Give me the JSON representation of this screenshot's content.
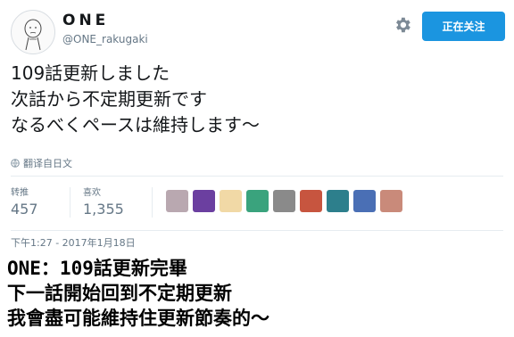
{
  "profile": {
    "display_name": "ONE",
    "handle": "@ONE_rakugaki",
    "avatar_icon": "doodle-face-avatar"
  },
  "actions": {
    "settings_icon": "gear-icon",
    "follow_label": "正在关注",
    "follow_color": "#1b95e0"
  },
  "tweet": {
    "lines": [
      "109話更新しました",
      "次話から不定期更新です",
      "なるべくペースは維持します〜"
    ],
    "translate_label": "翻译自日文"
  },
  "stats": {
    "retweets_label": "转推",
    "retweets_count": "457",
    "likes_label": "喜欢",
    "likes_count": "1,355"
  },
  "likers": [
    {
      "icon": "liker-avatar-1",
      "color": "#b9a8b0"
    },
    {
      "icon": "liker-avatar-2",
      "color": "#6b3fa0"
    },
    {
      "icon": "liker-avatar-3",
      "color": "#f1d9a6"
    },
    {
      "icon": "liker-avatar-4",
      "color": "#3aa37d"
    },
    {
      "icon": "liker-avatar-5",
      "color": "#8a8a8a"
    },
    {
      "icon": "liker-avatar-6",
      "color": "#c7553f"
    },
    {
      "icon": "liker-avatar-7",
      "color": "#2d7f8c"
    },
    {
      "icon": "liker-avatar-8",
      "color": "#4a6fb5"
    },
    {
      "icon": "liker-avatar-9",
      "color": "#c98a7a"
    }
  ],
  "meta": {
    "timestamp": "下午1:27 - 2017年1月18日"
  },
  "caption": {
    "lines": [
      "ONE：109話更新完畢",
      "下一話開始回到不定期更新",
      "我會盡可能維持住更新節奏的～"
    ]
  }
}
